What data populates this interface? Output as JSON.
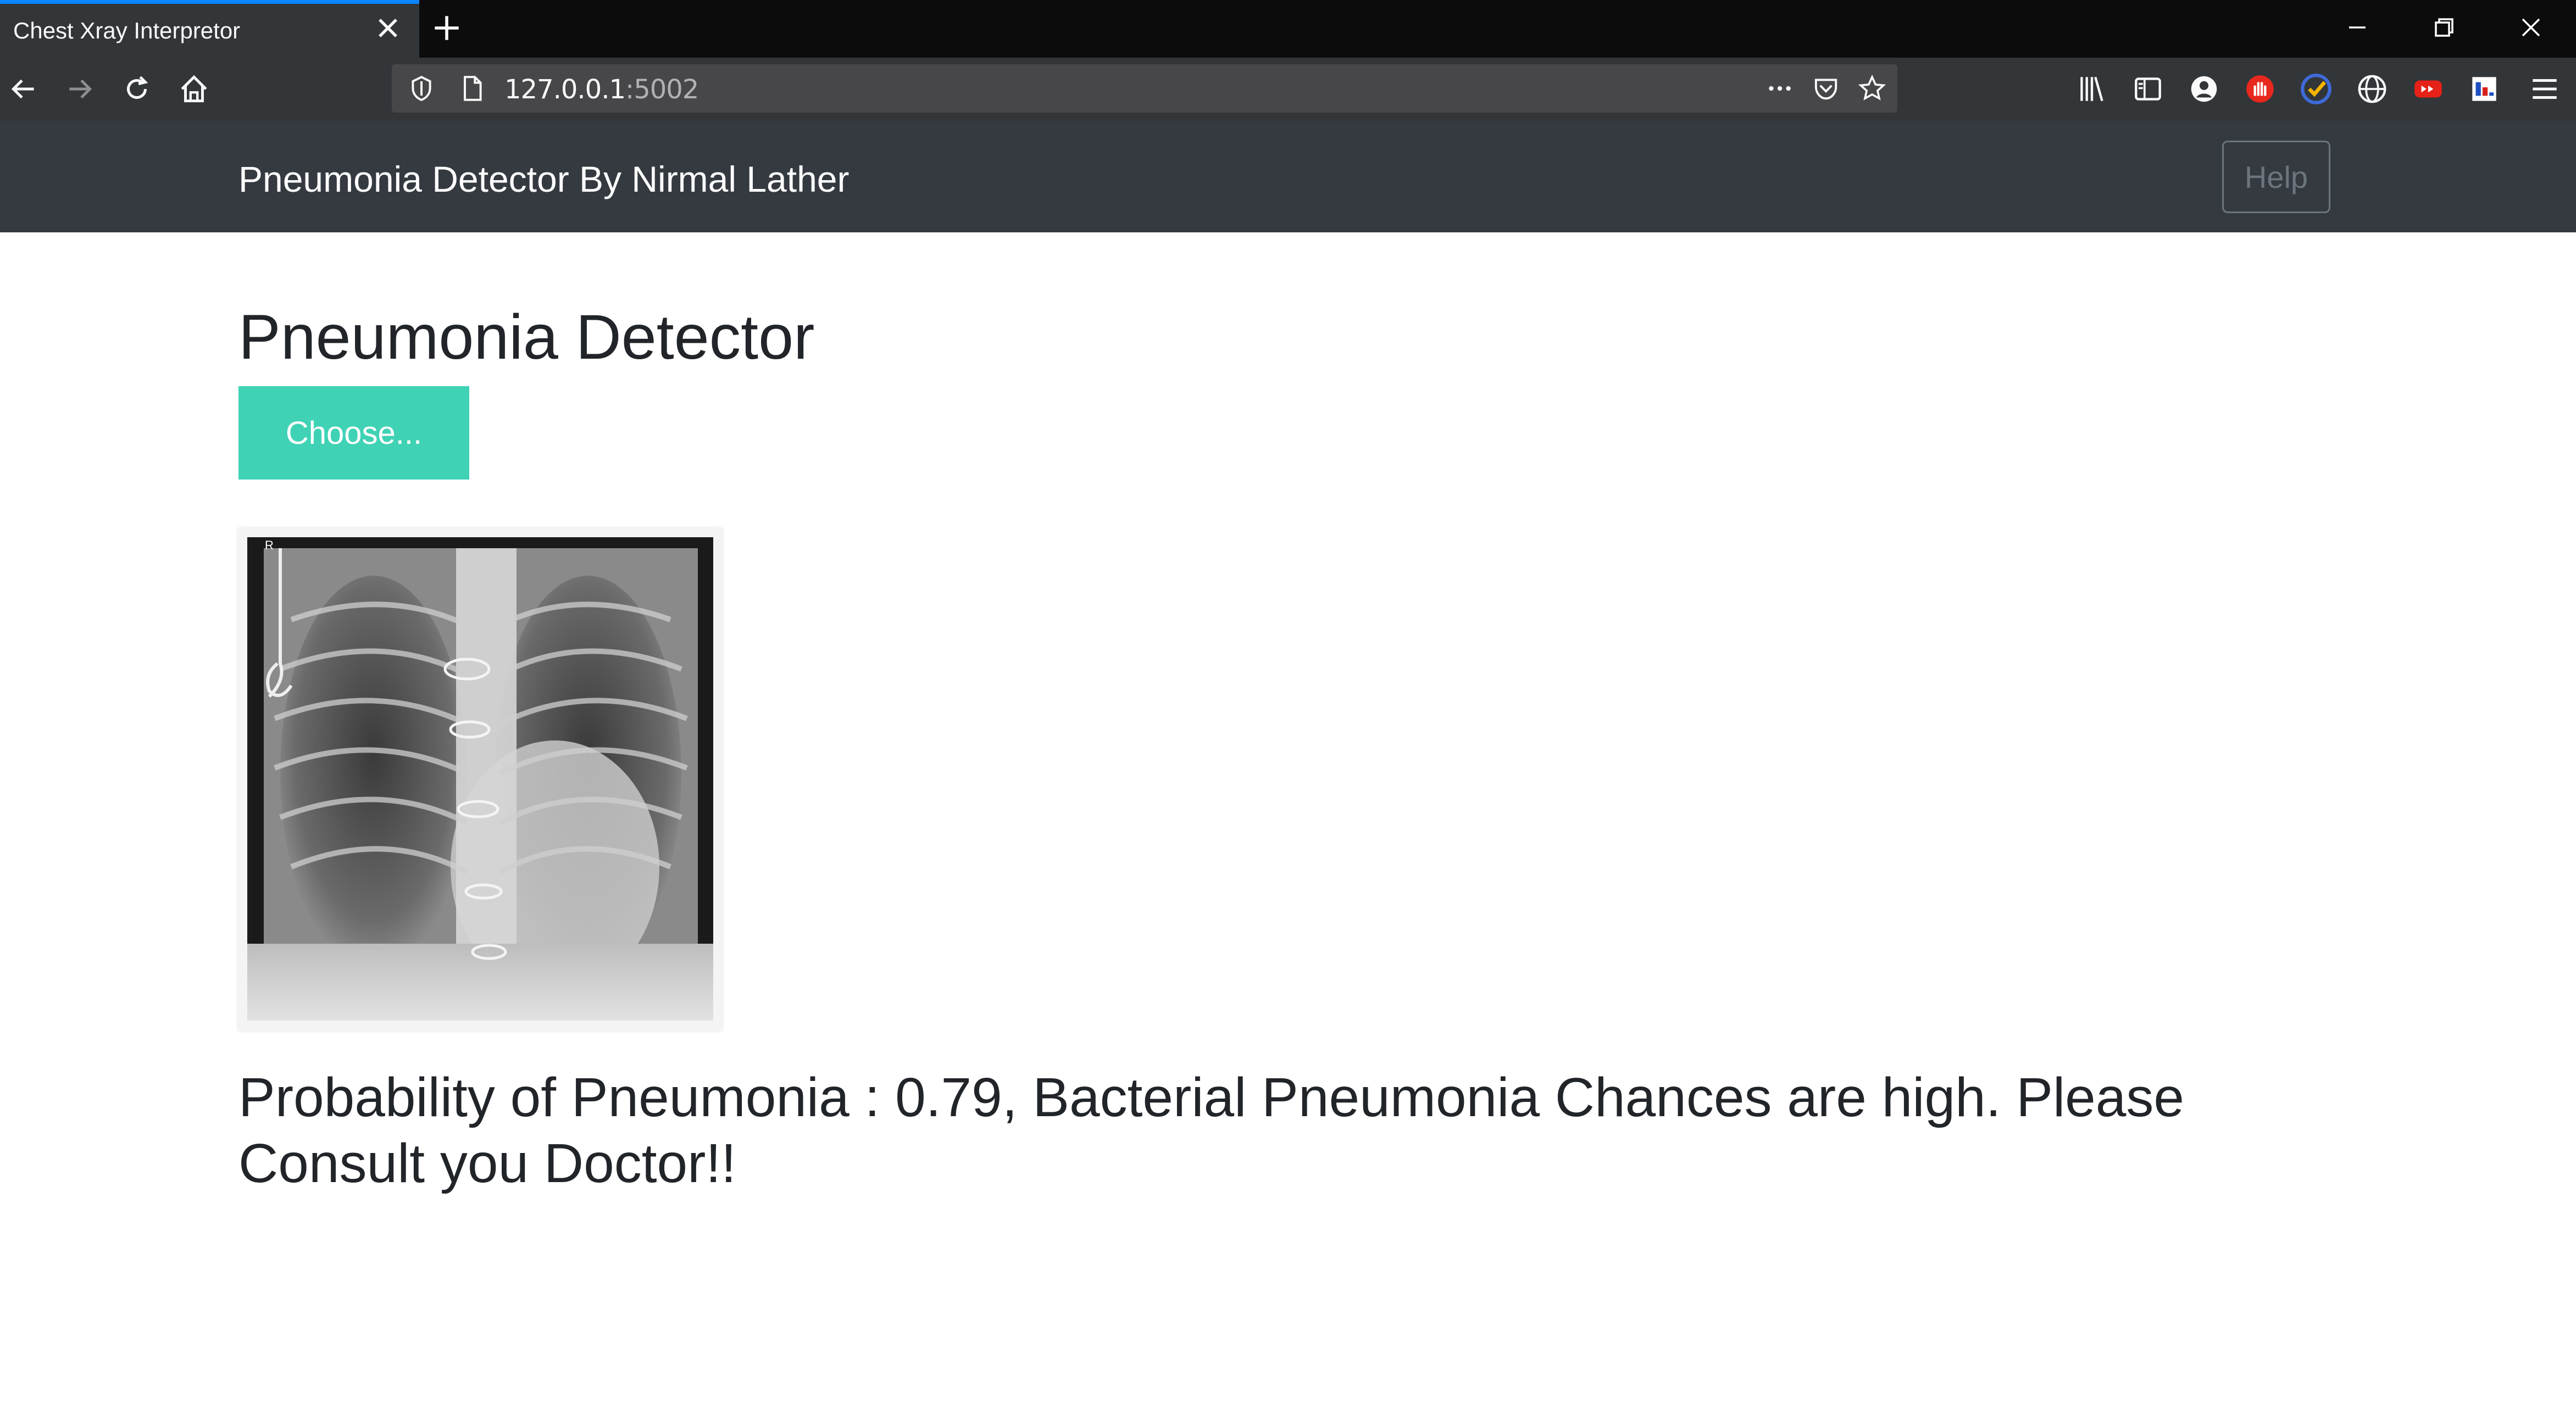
{
  "browser": {
    "tab_title": "Chest Xray Interpretor",
    "url_host": "127.0.0.1",
    "url_port": ":5002"
  },
  "app": {
    "brand": "Pneumonia Detector By Nirmal Lather",
    "help_label": "Help",
    "page_title": "Pneumonia Detector",
    "choose_label": "Choose...",
    "result_text": "Probability of Pneumonia : 0.79, Bacterial Pneumonia Chances are high. Please Consult you Doctor!!"
  },
  "colors": {
    "accent_button": "#40d2b5",
    "navbar_bg": "#343a40"
  },
  "icons": [
    "close-icon",
    "plus-icon",
    "minimize-icon",
    "restore-icon",
    "back-icon",
    "forward-icon",
    "reload-icon",
    "home-icon",
    "shield-icon",
    "page-icon",
    "more-icon",
    "pocket-icon",
    "star-icon",
    "library-icon",
    "sidebar-icon",
    "account-icon",
    "hand-stop-icon",
    "check-extension-icon",
    "globe-icon",
    "youtube-extension-icon",
    "flag-extension-icon",
    "menu-icon"
  ]
}
